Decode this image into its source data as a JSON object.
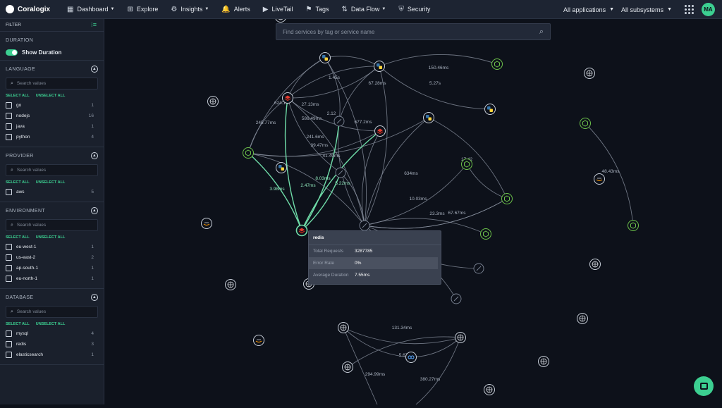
{
  "brand": "Coralogix",
  "nav": [
    {
      "label": "Dashboard",
      "icon": "dashboard-icon",
      "glyph": "▦",
      "caret": true
    },
    {
      "label": "Explore",
      "icon": "explore-icon",
      "glyph": "⊞",
      "caret": false
    },
    {
      "label": "Insights",
      "icon": "insights-icon",
      "glyph": "⚙",
      "caret": true
    },
    {
      "label": "Alerts",
      "icon": "bell-icon",
      "glyph": "🔔",
      "caret": false
    },
    {
      "label": "LiveTail",
      "icon": "play-icon",
      "glyph": "▶",
      "caret": false
    },
    {
      "label": "Tags",
      "icon": "tags-icon",
      "glyph": "⚑",
      "caret": false
    },
    {
      "label": "Data Flow",
      "icon": "data-flow-icon",
      "glyph": "⇅",
      "caret": true
    },
    {
      "label": "Security",
      "icon": "shield-icon",
      "glyph": "⛨",
      "caret": false
    }
  ],
  "header": {
    "applications": "All applications",
    "subsystems": "All subsystems",
    "avatar": "MA"
  },
  "sidebar": {
    "filter_label": "FILTER",
    "duration": {
      "title": "DURATION",
      "toggle_label": "Show Duration",
      "on": true
    },
    "select_all": "SELECT ALL",
    "unselect_all": "UNSELECT ALL",
    "search_placeholder": "Search values",
    "sections": [
      {
        "title": "LANGUAGE",
        "options": [
          {
            "name": "go",
            "count": "1"
          },
          {
            "name": "nodejs",
            "count": "16"
          },
          {
            "name": "java",
            "count": "1"
          },
          {
            "name": "python",
            "count": "4"
          }
        ]
      },
      {
        "title": "PROVIDER",
        "options": [
          {
            "name": "aws",
            "count": "5"
          }
        ]
      },
      {
        "title": "ENVIRONMENT",
        "options": [
          {
            "name": "eu-west-1",
            "count": "1"
          },
          {
            "name": "us-east-2",
            "count": "2"
          },
          {
            "name": "ap-south-1",
            "count": "1"
          },
          {
            "name": "eu-north-1",
            "count": "1"
          }
        ]
      },
      {
        "title": "DATABASE",
        "options": [
          {
            "name": "mysql",
            "count": "4"
          },
          {
            "name": "redis",
            "count": "3"
          },
          {
            "name": "elasticsearch",
            "count": "1"
          }
        ]
      }
    ]
  },
  "map": {
    "search_placeholder": "Find services by tag or service name",
    "edge_labels": [
      "150.46ms",
      "1.45s",
      "67.28ms",
      "5.27s",
      "624.1",
      "27.13ms",
      "586.49ms",
      "2.12",
      "677.2ms",
      "245.77ms",
      "241.6ms",
      "39.47ms",
      "17.42",
      "48.43ms",
      "41.49ms",
      "3.98ms",
      "2.47ms",
      "8.03ms",
      "5.22ms",
      "634ms",
      "10.03ms",
      "23.3ms",
      "67.67ms",
      "131.34ms",
      "5.67",
      "294.99ms",
      "380.27ms"
    ],
    "tooltip": {
      "title": "redis",
      "rows": [
        {
          "key": "Total Requests",
          "value": "3287785"
        },
        {
          "key": "Error Rate",
          "value": "0%"
        },
        {
          "key": "Average Duration",
          "value": "7.55ms"
        }
      ]
    }
  },
  "colors": {
    "accent": "#3ccf91",
    "background": "#0d111a",
    "edge": "#8e96a4",
    "highlight_edge": "#6fdca8"
  }
}
